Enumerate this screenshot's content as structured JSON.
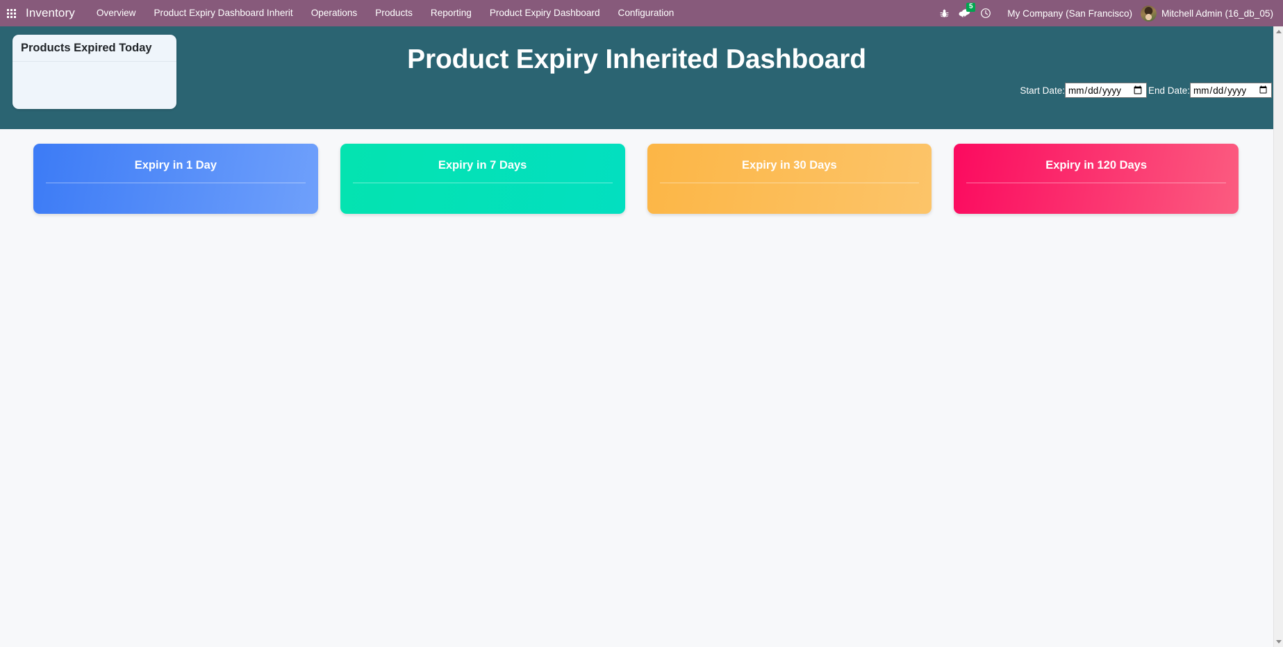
{
  "navbar": {
    "apps_icon": "apps-grid-icon",
    "brand": "Inventory",
    "menu": [
      {
        "label": "Overview"
      },
      {
        "label": "Product Expiry Dashboard Inherit"
      },
      {
        "label": "Operations"
      },
      {
        "label": "Products"
      },
      {
        "label": "Reporting"
      },
      {
        "label": "Product Expiry Dashboard"
      },
      {
        "label": "Configuration"
      }
    ],
    "icons": [
      {
        "name": "bug-icon"
      },
      {
        "name": "messages-icon",
        "badge": "5"
      },
      {
        "name": "clock-icon"
      }
    ],
    "company": "My Company (San Francisco)",
    "user": "Mitchell Admin (16_db_05)",
    "colors": {
      "navbar_bg": "#875a7b",
      "badge_bg": "#00a54f",
      "text": "#ffffff"
    }
  },
  "header": {
    "title": "Product Expiry Inherited Dashboard",
    "band_color": "#2b6472"
  },
  "expired_today_card": {
    "title": "Products Expired Today",
    "value": "",
    "bg_color": "#eff5fb"
  },
  "filters": {
    "start_label": "Start Date:",
    "start_value": "",
    "start_placeholder": "dd/mm/yyyy",
    "end_label": "End Date:",
    "end_value": "",
    "end_placeholder": "dd/mm/yyyy"
  },
  "kpi_cards": [
    {
      "title": "Expiry in 1 Day",
      "value": "",
      "color": "#3c7bf6",
      "variant": "kpi-blue"
    },
    {
      "title": "Expiry in 7 Days",
      "value": "",
      "color": "#04e3b0",
      "variant": "kpi-green"
    },
    {
      "title": "Expiry in 30 Days",
      "value": "",
      "color": "#fcb646",
      "variant": "kpi-orange"
    },
    {
      "title": "Expiry in 120 Days",
      "value": "",
      "color": "#fb0a5f",
      "variant": "kpi-pink"
    }
  ],
  "page": {
    "background": "#f7f8fa"
  }
}
